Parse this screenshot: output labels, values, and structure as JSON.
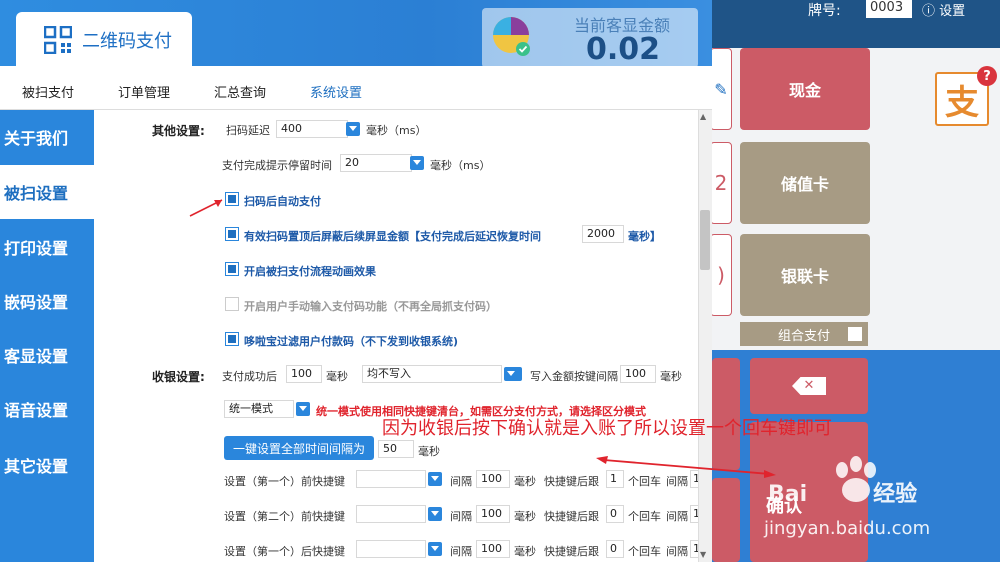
{
  "app": {
    "title": "二维码支付"
  },
  "amount": {
    "label": "当前客显金额",
    "value": "0.02"
  },
  "pos": {
    "brand_label": "牌号:",
    "brand_value": "0003",
    "settings_label": "设置",
    "cash_label": "现金",
    "stored_value_label": "储值卡",
    "unionpay_label": "银联卡",
    "combo_label": "组合支付",
    "left_glyph_1": "2",
    "left_glyph_2": ")",
    "confirm_partial": "确认",
    "alipay_glyph": "支",
    "help_glyph": "?"
  },
  "nav": {
    "items": [
      "被扫支付",
      "订单管理",
      "汇总查询",
      "系统设置"
    ]
  },
  "sidebar": {
    "items": [
      "关于我们",
      "被扫设置",
      "打印设置",
      "嵌码设置",
      "客显设置",
      "语音设置",
      "其它设置"
    ]
  },
  "other": {
    "section_label": "其他设置:",
    "scan_delay_label": "扫码延迟",
    "scan_delay_value": "400",
    "ms_unit": "毫秒（ms）",
    "pay_done_label": "支付完成提示停留时间",
    "pay_done_value": "20",
    "ms_unit2": "毫秒（ms）"
  },
  "checkboxes": [
    {
      "label": "扫码后自动支付",
      "checked": true
    },
    {
      "label": "有效扫码置顶后屏蔽后续屏显金额【支付完成后延迟恢复时间",
      "checked": true,
      "value": "2000",
      "suffix": "毫秒】"
    },
    {
      "label": "开启被扫支付流程动画效果",
      "checked": true
    },
    {
      "label": "开启用户手动输入支付码功能（不再全局抓支付码）",
      "checked": false
    },
    {
      "label": "哆啦宝过滤用户付款码（不下发到收银系统)",
      "checked": true
    }
  ],
  "cashier": {
    "section_label": "收银设置:",
    "after_pay_label": "支付成功后",
    "after_pay_value": "100",
    "ms": "毫秒",
    "write_mode_value": "均不写入",
    "write_key_interval_label": "写入金额按键间隔",
    "write_key_interval_value": "100",
    "mode_value": "统一模式",
    "mode_note": "统一模式使用相同快捷键清台，如需区分支付方式，请选择区分模式",
    "one_key_btn": "一键设置全部时间间隔为",
    "one_key_value": "50",
    "one_key_unit": "毫秒"
  },
  "shortcut_rows": [
    {
      "label": "设置（第一个）前快捷键",
      "interval_label": "间隔",
      "interval": "100",
      "ms": "毫秒",
      "after_label": "快捷键后跟",
      "count": "1",
      "enter_label": "个回车",
      "gap_label": "间隔",
      "gap": "1"
    },
    {
      "label": "设置（第二个）前快捷键",
      "interval_label": "间隔",
      "interval": "100",
      "ms": "毫秒",
      "after_label": "快捷键后跟",
      "count": "0",
      "enter_label": "个回车",
      "gap_label": "间隔",
      "gap": "1"
    },
    {
      "label": "设置（第一个）后快捷键",
      "interval_label": "间隔",
      "interval": "100",
      "ms": "毫秒",
      "after_label": "快捷键后跟",
      "count": "0",
      "enter_label": "个回车",
      "gap_label": "间隔",
      "gap": "1"
    }
  ],
  "annotation": "因为收银后按下确认就是入账了所以设置一个回车键即可",
  "watermark": {
    "brand": "Bai",
    "brand2": "经验",
    "url": "jingyan.baidu.com"
  },
  "colors": {
    "accent": "#2a86dc",
    "red_button": "#cc5b66",
    "khaki_button": "#a79b84",
    "annotation": "#e0242d"
  }
}
